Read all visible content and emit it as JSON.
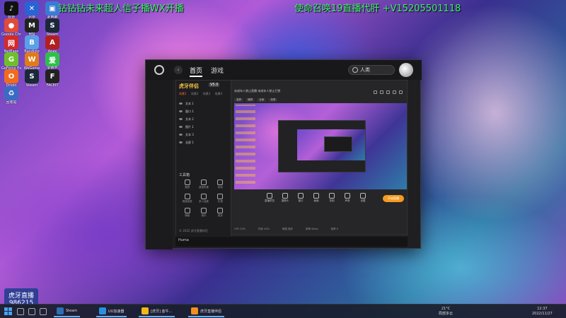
{
  "overlay": {
    "left_text": "钻钻钻未来超人信子播WX开播",
    "right_text": "使命召唤19直播代肝  +V15205501118"
  },
  "desktop_icons": [
    {
      "label": "抖音",
      "color": "#111111",
      "glyph": "♪"
    },
    {
      "label": "迅雷",
      "color": "#2a63d4",
      "glyph": "✕"
    },
    {
      "label": "此电脑",
      "color": "#3b7bd4",
      "glyph": "▣"
    },
    {
      "label": "Google Chrome",
      "color": "#e04b3a",
      "glyph": "●"
    },
    {
      "label": "MSI",
      "color": "#222222",
      "glyph": "M"
    },
    {
      "label": "Steam",
      "color": "#1b2838",
      "glyph": "S"
    },
    {
      "label": "NetEase",
      "color": "#d42a2a",
      "glyph": "网"
    },
    {
      "label": "Bandizip",
      "color": "#5aa0e6",
      "glyph": "B"
    },
    {
      "label": "Apex",
      "color": "#b12020",
      "glyph": "A"
    },
    {
      "label": "GeForce Experience",
      "color": "#6fbf2d",
      "glyph": "G"
    },
    {
      "label": "WeGame",
      "color": "#e07b1a",
      "glyph": "W"
    },
    {
      "label": "爱奇艺",
      "color": "#2ec04a",
      "glyph": "爱"
    },
    {
      "label": "Origin",
      "color": "#f26b1d",
      "glyph": "O"
    },
    {
      "label": "Steam",
      "color": "#1b2838",
      "glyph": "S"
    },
    {
      "label": "FACEIT",
      "color": "#222222",
      "glyph": "F"
    },
    {
      "label": "回收站",
      "color": "#3a6bc4",
      "glyph": "♻"
    }
  ],
  "watermark": {
    "title": "虎牙直播",
    "room_id": "986215"
  },
  "app": {
    "tabs": [
      {
        "label": "首页",
        "active": true
      },
      {
        "label": "游戏",
        "active": false
      }
    ],
    "search_text": "人类",
    "studio": {
      "brand": "虎牙伴侣",
      "version": "V5.0",
      "tabs": [
        "场景1",
        "场景2",
        "场景3",
        "场景4"
      ],
      "scenes": [
        "文本 1",
        "窗口 1",
        "文本 2",
        "图片 1",
        "文本 3",
        "全屏 1"
      ],
      "tool_title": "工具箱",
      "tools": [
        "美颜",
        "虚拟形象",
        "特效",
        "视频连麦",
        "多人连麦",
        "礼物",
        "弹幕",
        "音乐",
        "更多"
      ],
      "preview_title": "未成年人禁止直播 未成年人禁止打赏",
      "preview_tabs": [
        "竖屏",
        "横屏",
        "全景",
        "录屏"
      ],
      "controls": [
        "直播预览",
        "摄像头",
        "窗口",
        "画面",
        "录制",
        "声音",
        "设置"
      ],
      "go_live": "开始直播",
      "status_items": [
        "CPU 23%",
        "内存 45%",
        "网络 良好",
        "码率 0kb/s",
        "帧率 0"
      ],
      "footer": "© 2022 虎牙直播伴侣",
      "thumb_text": "Huma"
    }
  },
  "taskbar": {
    "apps": [
      {
        "name": "Steam",
        "color": "#2f6fb4"
      },
      {
        "name": "UU加速器",
        "color": "#2a8fdf"
      },
      {
        "name": "[虎牙] 金牛...",
        "color": "#f0b81b"
      },
      {
        "name": "虎牙直播伴侣",
        "color": "#f09020"
      }
    ],
    "weather_temp": "21°C",
    "weather_desc": "局部多云",
    "time": "12:37",
    "date": "2022/11/27"
  }
}
